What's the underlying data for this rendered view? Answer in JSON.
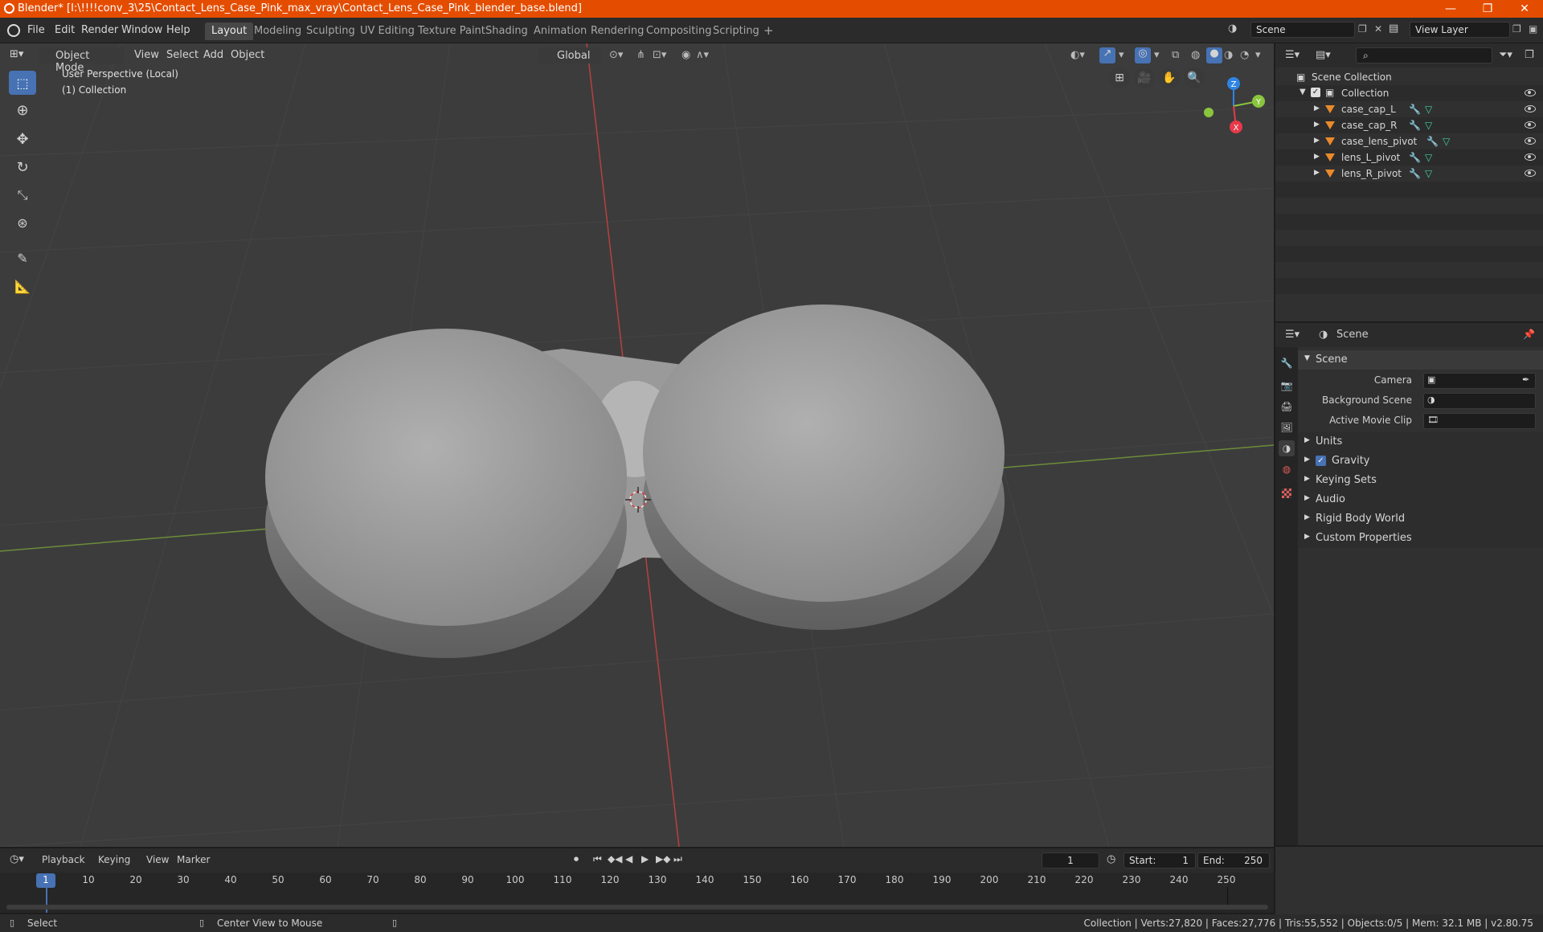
{
  "titlebar": {
    "title": "Blender* [I:\\!!!!conv_3\\25\\Contact_Lens_Case_Pink_max_vray\\Contact_Lens_Case_Pink_blender_base.blend]",
    "minimize": "—",
    "maximize": "❐",
    "close": "✕"
  },
  "menu": {
    "items": [
      "File",
      "Edit",
      "Render",
      "Window",
      "Help"
    ],
    "workspaces": [
      "Layout",
      "Modeling",
      "Sculpting",
      "UV Editing",
      "Texture Paint",
      "Shading",
      "Animation",
      "Rendering",
      "Compositing",
      "Scripting"
    ],
    "add_workspace": "+",
    "scene_name": "Scene",
    "view_layer": "View Layer"
  },
  "viewport": {
    "mode": "Object Mode",
    "menus": [
      "View",
      "Select",
      "Add",
      "Object"
    ],
    "orientation": "Global",
    "info_line1": "User Perspective (Local)",
    "info_line2": "(1) Collection",
    "gizmo": {
      "x": "X",
      "y": "Y",
      "z": "Z"
    }
  },
  "outliner": {
    "root": "Scene Collection",
    "collection": "Collection",
    "objects": [
      "case_cap_L",
      "case_cap_R",
      "case_lens_pivot",
      "lens_L_pivot",
      "lens_R_pivot"
    ]
  },
  "properties": {
    "header": "Scene",
    "panel_title": "Scene",
    "camera_label": "Camera",
    "background_label": "Background Scene",
    "movieclip_label": "Active Movie Clip",
    "sections": [
      "Units",
      "Gravity",
      "Keying Sets",
      "Audio",
      "Rigid Body World",
      "Custom Properties"
    ]
  },
  "timeline": {
    "menus": [
      "Playback",
      "Keying",
      "View",
      "Marker"
    ],
    "current_frame": "1",
    "start_label": "Start:",
    "start_value": "1",
    "end_label": "End:",
    "end_value": "250",
    "ruler": [
      "1",
      "10",
      "20",
      "30",
      "40",
      "50",
      "60",
      "70",
      "80",
      "90",
      "100",
      "110",
      "120",
      "130",
      "140",
      "150",
      "160",
      "170",
      "180",
      "190",
      "200",
      "210",
      "220",
      "230",
      "240",
      "250"
    ]
  },
  "statusbar": {
    "select": "Select",
    "center": "Center View to Mouse",
    "stats": "Collection | Verts:27,820 | Faces:27,776 | Tris:55,552 | Objects:0/5 | Mem: 32.1 MB | v2.80.75"
  },
  "colors": {
    "title_bg": "#e44d00",
    "active_tool": "#4772b3",
    "axis_x": "#e8394a",
    "axis_y": "#8ac53e",
    "axis_z": "#2f84e3",
    "object_orange": "#e88a2c"
  }
}
